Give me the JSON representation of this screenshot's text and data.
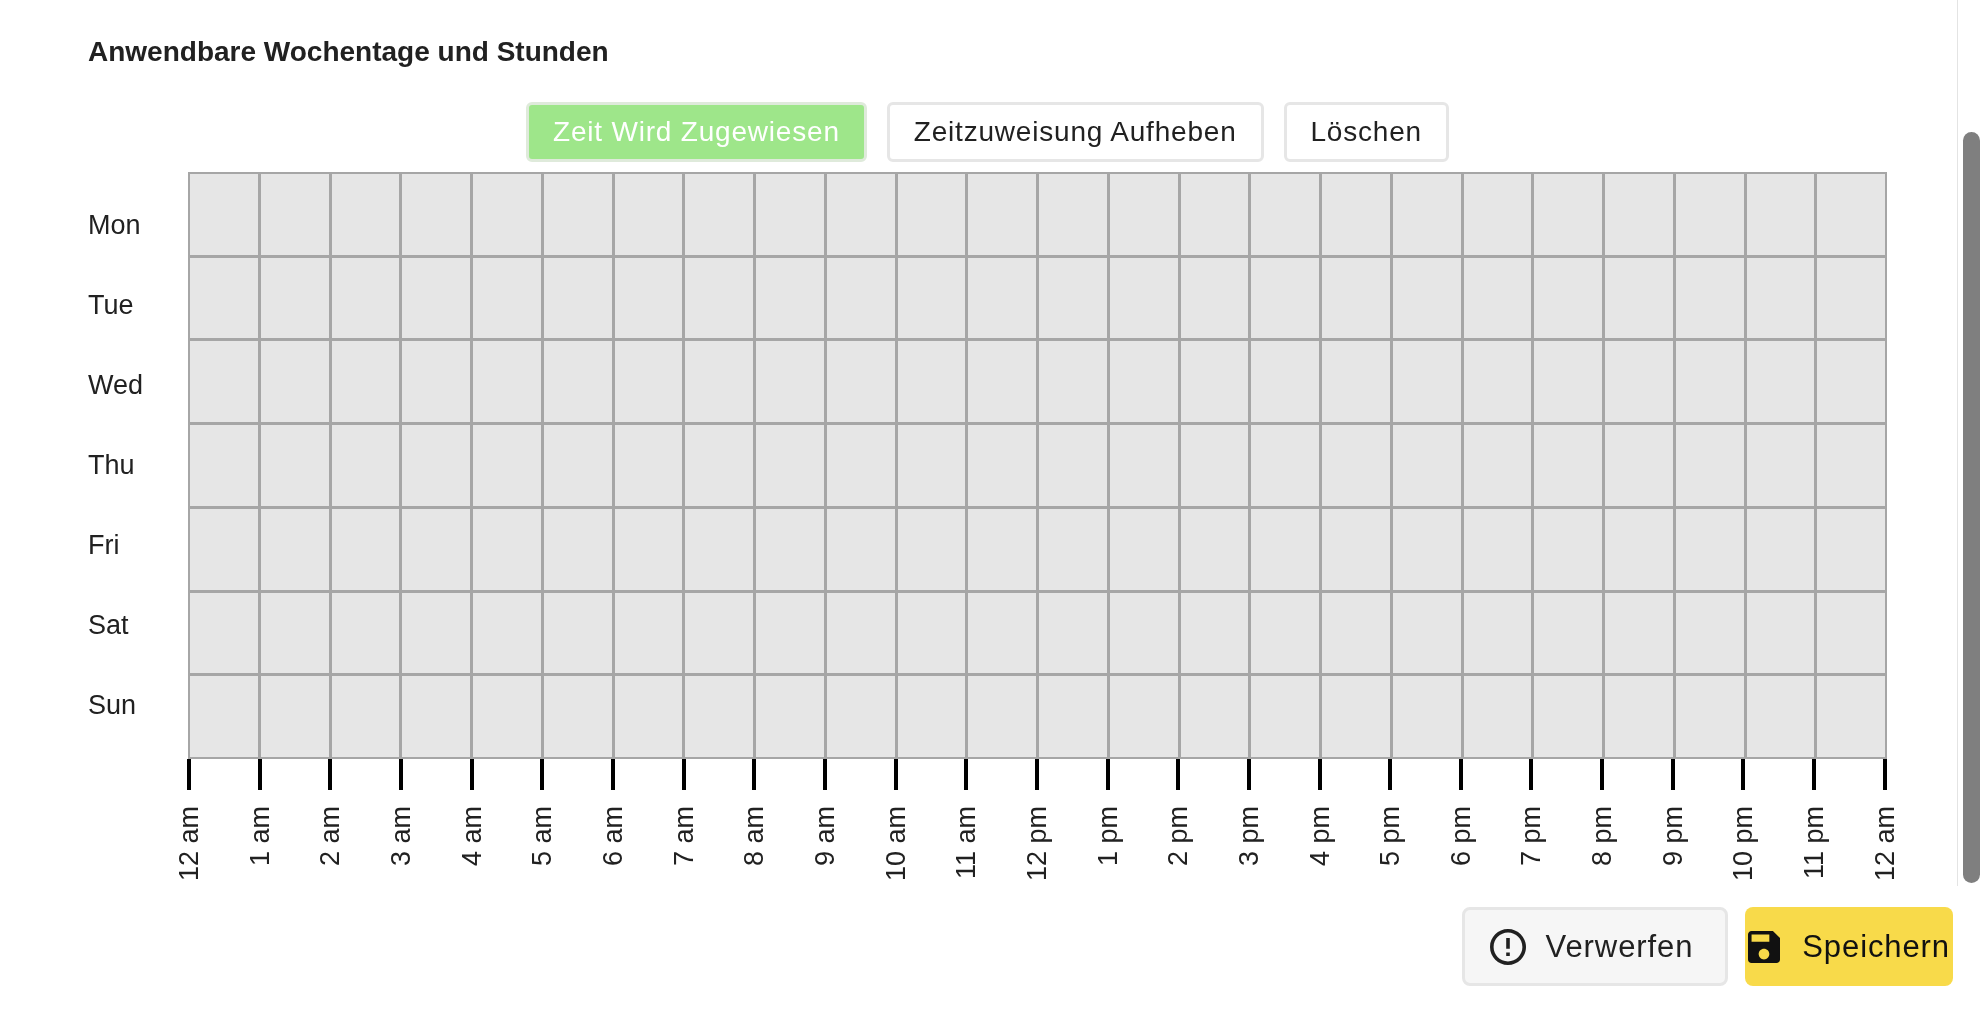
{
  "section": {
    "title": "Anwendbare Wochentage und Stunden"
  },
  "mode_buttons": [
    {
      "label": "Zeit Wird Zugewiesen",
      "selected": true
    },
    {
      "label": "Zeitzuweisung Aufheben",
      "selected": false
    },
    {
      "label": "Löschen"
    }
  ],
  "schedule": {
    "days": [
      {
        "label": "Mon",
        "slots": [
          {
            "selected": false
          },
          {
            "selected": false
          },
          {
            "selected": false
          },
          {
            "selected": false
          },
          {
            "selected": false
          },
          {
            "selected": false
          },
          {
            "selected": false
          },
          {
            "selected": false
          },
          {
            "selected": false
          },
          {
            "selected": false
          },
          {
            "selected": false
          },
          {
            "selected": false
          },
          {
            "selected": false
          },
          {
            "selected": false
          },
          {
            "selected": false
          },
          {
            "selected": false
          },
          {
            "selected": false
          },
          {
            "selected": false
          },
          {
            "selected": false
          },
          {
            "selected": false
          },
          {
            "selected": false
          },
          {
            "selected": false
          },
          {
            "selected": false
          },
          {
            "selected": false
          }
        ]
      },
      {
        "label": "Tue",
        "slots": [
          {
            "selected": false
          },
          {
            "selected": false
          },
          {
            "selected": false
          },
          {
            "selected": false
          },
          {
            "selected": false
          },
          {
            "selected": false
          },
          {
            "selected": false
          },
          {
            "selected": false
          },
          {
            "selected": false
          },
          {
            "selected": false
          },
          {
            "selected": false
          },
          {
            "selected": false
          },
          {
            "selected": false
          },
          {
            "selected": false
          },
          {
            "selected": false
          },
          {
            "selected": false
          },
          {
            "selected": false
          },
          {
            "selected": false
          },
          {
            "selected": false
          },
          {
            "selected": false
          },
          {
            "selected": false
          },
          {
            "selected": false
          },
          {
            "selected": false
          },
          {
            "selected": false
          }
        ]
      },
      {
        "label": "Wed",
        "slots": [
          {
            "selected": false
          },
          {
            "selected": false
          },
          {
            "selected": false
          },
          {
            "selected": false
          },
          {
            "selected": false
          },
          {
            "selected": false
          },
          {
            "selected": false
          },
          {
            "selected": false
          },
          {
            "selected": false
          },
          {
            "selected": false
          },
          {
            "selected": false
          },
          {
            "selected": false
          },
          {
            "selected": false
          },
          {
            "selected": false
          },
          {
            "selected": false
          },
          {
            "selected": false
          },
          {
            "selected": false
          },
          {
            "selected": false
          },
          {
            "selected": false
          },
          {
            "selected": false
          },
          {
            "selected": false
          },
          {
            "selected": false
          },
          {
            "selected": false
          },
          {
            "selected": false
          }
        ]
      },
      {
        "label": "Thu",
        "slots": [
          {
            "selected": false
          },
          {
            "selected": false
          },
          {
            "selected": false
          },
          {
            "selected": false
          },
          {
            "selected": false
          },
          {
            "selected": false
          },
          {
            "selected": false
          },
          {
            "selected": false
          },
          {
            "selected": false
          },
          {
            "selected": false
          },
          {
            "selected": false
          },
          {
            "selected": false
          },
          {
            "selected": false
          },
          {
            "selected": false
          },
          {
            "selected": false
          },
          {
            "selected": false
          },
          {
            "selected": false
          },
          {
            "selected": false
          },
          {
            "selected": false
          },
          {
            "selected": false
          },
          {
            "selected": false
          },
          {
            "selected": false
          },
          {
            "selected": false
          },
          {
            "selected": false
          }
        ]
      },
      {
        "label": "Fri",
        "slots": [
          {
            "selected": false
          },
          {
            "selected": false
          },
          {
            "selected": false
          },
          {
            "selected": false
          },
          {
            "selected": false
          },
          {
            "selected": false
          },
          {
            "selected": false
          },
          {
            "selected": false
          },
          {
            "selected": false
          },
          {
            "selected": false
          },
          {
            "selected": false
          },
          {
            "selected": false
          },
          {
            "selected": false
          },
          {
            "selected": false
          },
          {
            "selected": false
          },
          {
            "selected": false
          },
          {
            "selected": false
          },
          {
            "selected": false
          },
          {
            "selected": false
          },
          {
            "selected": false
          },
          {
            "selected": false
          },
          {
            "selected": false
          },
          {
            "selected": false
          },
          {
            "selected": false
          }
        ]
      },
      {
        "label": "Sat",
        "slots": [
          {
            "selected": false
          },
          {
            "selected": false
          },
          {
            "selected": false
          },
          {
            "selected": false
          },
          {
            "selected": false
          },
          {
            "selected": false
          },
          {
            "selected": false
          },
          {
            "selected": false
          },
          {
            "selected": false
          },
          {
            "selected": false
          },
          {
            "selected": false
          },
          {
            "selected": false
          },
          {
            "selected": false
          },
          {
            "selected": false
          },
          {
            "selected": false
          },
          {
            "selected": false
          },
          {
            "selected": false
          },
          {
            "selected": false
          },
          {
            "selected": false
          },
          {
            "selected": false
          },
          {
            "selected": false
          },
          {
            "selected": false
          },
          {
            "selected": false
          },
          {
            "selected": false
          }
        ]
      },
      {
        "label": "Sun",
        "slots": [
          {
            "selected": false
          },
          {
            "selected": false
          },
          {
            "selected": false
          },
          {
            "selected": false
          },
          {
            "selected": false
          },
          {
            "selected": false
          },
          {
            "selected": false
          },
          {
            "selected": false
          },
          {
            "selected": false
          },
          {
            "selected": false
          },
          {
            "selected": false
          },
          {
            "selected": false
          },
          {
            "selected": false
          },
          {
            "selected": false
          },
          {
            "selected": false
          },
          {
            "selected": false
          },
          {
            "selected": false
          },
          {
            "selected": false
          },
          {
            "selected": false
          },
          {
            "selected": false
          },
          {
            "selected": false
          },
          {
            "selected": false
          },
          {
            "selected": false
          },
          {
            "selected": false
          }
        ]
      }
    ],
    "hour_ticks": [
      "12 am",
      "1 am",
      "2 am",
      "3 am",
      "4 am",
      "5 am",
      "6 am",
      "7 am",
      "8 am",
      "9 am",
      "10 am",
      "11 am",
      "12 pm",
      "1 pm",
      "2 pm",
      "3 pm",
      "4 pm",
      "5 pm",
      "6 pm",
      "7 pm",
      "8 pm",
      "9 pm",
      "10 pm",
      "11 pm",
      "12 am"
    ]
  },
  "footer": {
    "buttons": [
      {
        "label": "Verwerfen",
        "kind": "discard"
      },
      {
        "label": "Speichern",
        "kind": "save"
      }
    ]
  }
}
